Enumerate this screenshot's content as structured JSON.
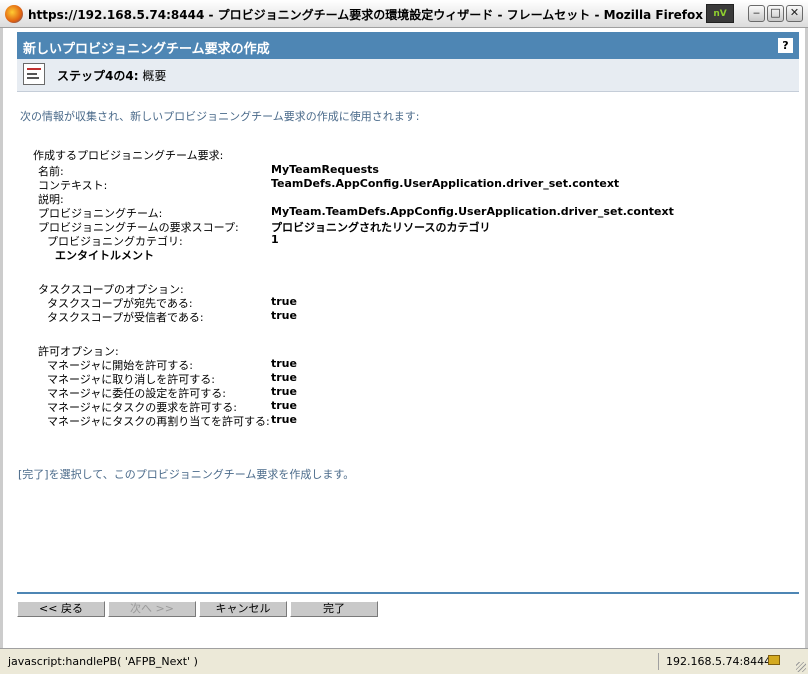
{
  "window": {
    "title": "https://192.168.5.74:8444 - プロビジョニングチーム要求の環境設定ウィザード - フレームセット - Mozilla Firefox",
    "icon": "firefox-icon",
    "tray_icon_label": "nV",
    "controls": [
      "minimize",
      "maximize",
      "close"
    ]
  },
  "header": {
    "title": "新しいプロビジョニングチーム要求の作成",
    "help_label": "?"
  },
  "step": {
    "icon": "wizard-step-icon",
    "step_text": "ステップ4の4:",
    "step_name": "概要"
  },
  "intro": "次の情報が収集され、新しいプロビジョニングチーム要求の作成に使用されます:",
  "summary": {
    "heading": "作成するプロビジョニングチーム要求:",
    "name_label": "名前:",
    "name_value": "MyTeamRequests",
    "context_label": "コンテキスト:",
    "context_value": "TeamDefs.AppConfig.UserApplication.driver_set.context",
    "description_label": "説明:",
    "team_label": "プロビジョニングチーム:",
    "team_value": "MyTeam.TeamDefs.AppConfig.UserApplication.driver_set.context",
    "scope_label": "プロビジョニングチームの要求スコープ:",
    "scope_value": "プロビジョニングされたリソースのカテゴリ",
    "category_label": "プロビジョニングカテゴリ:",
    "category_value": "1",
    "entitlement": "エンタイトルメント"
  },
  "task_scope": {
    "heading": "タスクスコープのオプション:",
    "items": [
      {
        "label": "タスクスコープが宛先である:",
        "value": "true"
      },
      {
        "label": "タスクスコープが受信者である:",
        "value": "true"
      }
    ]
  },
  "permissions": {
    "heading": "許可オプション:",
    "items": [
      {
        "label": "マネージャに開始を許可する:",
        "value": "true"
      },
      {
        "label": "マネージャに取り消しを許可する:",
        "value": "true"
      },
      {
        "label": "マネージャに委任の設定を許可する:",
        "value": "true"
      },
      {
        "label": "マネージャにタスクの要求を許可する:",
        "value": "true"
      },
      {
        "label": "マネージャにタスクの再割り当てを許可する:",
        "value": "true"
      }
    ]
  },
  "finish_text": "[完了]を選択して、このプロビジョニングチーム要求を作成します。",
  "buttons": {
    "back": "<< 戻る",
    "next": "次へ >>",
    "cancel": "キャンセル",
    "finish": "完了"
  },
  "status": {
    "left": "javascript:handlePB( 'AFPB_Next' )",
    "right": "192.168.5.74:8444",
    "lock_icon": "lock-icon"
  },
  "colors": {
    "header_bg": "#4e86b4",
    "step_bg": "#e7ecf2",
    "intro_text": "#4a6a8a"
  }
}
